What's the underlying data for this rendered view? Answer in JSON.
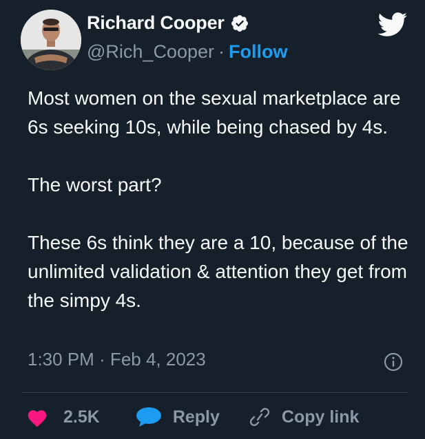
{
  "author": {
    "display_name": "Richard Cooper",
    "handle": "@Rich_Cooper",
    "separator": "·",
    "follow_label": "Follow",
    "verified": true
  },
  "tweet": {
    "paragraphs": [
      "Most women on the sexual marketplace are 6s seeking 10s, while being chased by 4s.",
      "The worst part?",
      "These 6s think they are a 10, because of the unlimited validation & attention they get from the simpy 4s."
    ],
    "timestamp": "1:30 PM · Feb 4, 2023"
  },
  "actions": {
    "likes": "2.5K",
    "reply_label": "Reply",
    "copy_link_label": "Copy link"
  },
  "colors": {
    "background": "#15202b",
    "text": "#f7f9f9",
    "secondary_text": "#8b98a5",
    "accent": "#1d9bf0",
    "like": "#f91880",
    "divider": "#38444d"
  },
  "icons": {
    "verified": "verified-badge-icon",
    "brand": "twitter-bird-icon",
    "info": "info-icon",
    "like": "heart-icon",
    "reply": "speech-bubble-icon",
    "copy_link": "link-icon"
  }
}
